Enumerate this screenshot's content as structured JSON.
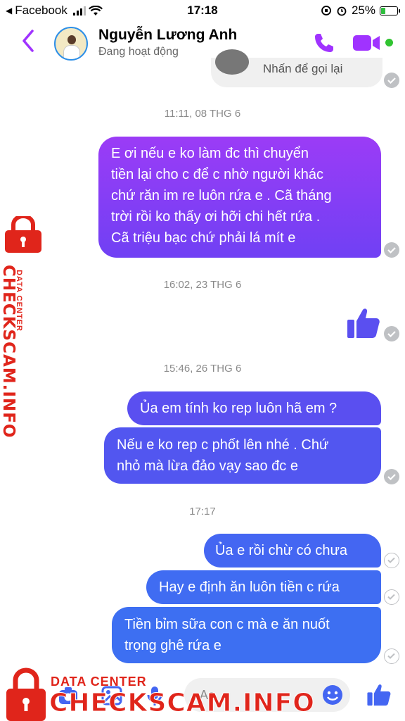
{
  "status_bar": {
    "back_app": "Facebook",
    "time": "17:18",
    "battery": "25%",
    "battery_level": 0.25
  },
  "header": {
    "contact_name": "Nguyễn Lương Anh",
    "contact_status": "Đang hoạt động",
    "icons": [
      "back-chevron-icon",
      "phone-icon",
      "video-camera-icon",
      "active-dot"
    ]
  },
  "call_card": {
    "text": "Nhấn để gọi lại"
  },
  "messages": [
    {
      "type": "timestamp",
      "text": "11:11, 08 THG 6"
    },
    {
      "type": "outgoing",
      "lines": [
        "E ơi nếu e ko làm đc thì chuyển",
        "tiền lại cho c để c nhờ người khác",
        "chứ răn im re luôn rứa e . Cã tháng",
        "trời rồi ko thấy ơi hỡi chi hết rứa .",
        "Cã triệu bạc chứ phải lá mít e"
      ]
    },
    {
      "type": "timestamp",
      "text": "16:02, 23 THG 6"
    },
    {
      "type": "like",
      "icon": "thumbs-up-icon"
    },
    {
      "type": "timestamp",
      "text": "15:46, 26 THG 6"
    },
    {
      "type": "outgoing",
      "lines": [
        "Ủa em tính ko rep luôn hã em ?"
      ]
    },
    {
      "type": "outgoing",
      "lines": [
        "Nếu e ko rep c phốt lên nhé . Chứ",
        "nhỏ mà lừa đảo vạy sao đc e"
      ]
    },
    {
      "type": "timestamp",
      "text": "17:17"
    },
    {
      "type": "outgoing",
      "lines": [
        "Ủa e rồi chừ có chưa"
      ]
    },
    {
      "type": "outgoing",
      "lines": [
        "Hay e định ăn luôn tiền c rứa"
      ]
    },
    {
      "type": "outgoing",
      "lines": [
        "Tiền bỉm sữa con c mà e ăn nuốt",
        "trọng ghê rứa e"
      ]
    }
  ],
  "composer": {
    "placeholder": "Aa",
    "icons": [
      "camera-icon",
      "image-icon",
      "microphone-icon",
      "emoji-icon",
      "thumbs-up-icon"
    ]
  },
  "watermark": {
    "small": "DATA CENTER",
    "big": "CHECKSCAM.INFO"
  },
  "colors": {
    "accent": "#a033ff",
    "bubble_top": "#8a3cf5",
    "bubble_mid": "#5a4ff0",
    "bubble_bottom": "#3d6ff2",
    "watermark_red": "#e0251b"
  }
}
